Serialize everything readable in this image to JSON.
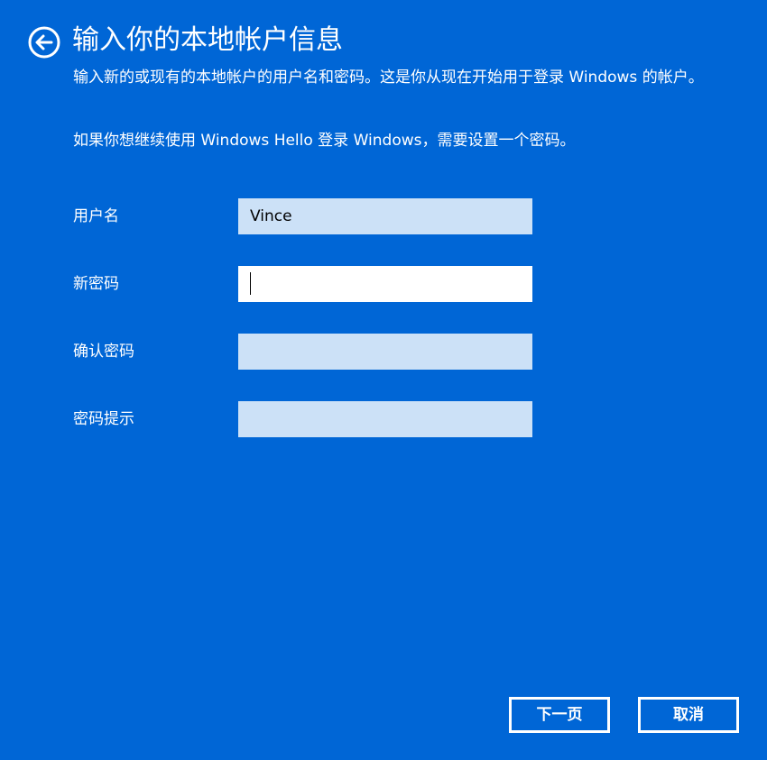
{
  "header": {
    "title": "输入你的本地帐户信息",
    "back_icon": "back-arrow-icon"
  },
  "content": {
    "description": "输入新的或现有的本地帐户的用户名和密码。这是你从现在开始用于登录 Windows 的帐户。",
    "hello_note": "如果你想继续使用 Windows Hello 登录 Windows，需要设置一个密码。"
  },
  "form": {
    "username": {
      "label": "用户名",
      "value": "Vince"
    },
    "new_password": {
      "label": "新密码",
      "value": ""
    },
    "confirm_password": {
      "label": "确认密码",
      "value": ""
    },
    "password_hint": {
      "label": "密码提示",
      "value": ""
    }
  },
  "buttons": {
    "next": "下一页",
    "cancel": "取消"
  },
  "colors": {
    "background": "#0066d6",
    "input_background": "#cce1f7",
    "active_input_background": "#ffffff",
    "text": "#ffffff"
  }
}
